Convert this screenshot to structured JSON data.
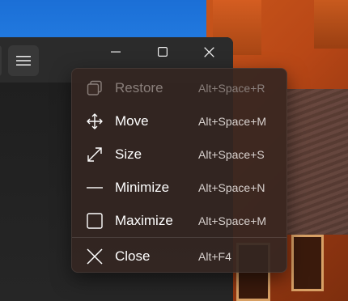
{
  "window": {
    "caption_buttons": {
      "minimize": "minimize-icon",
      "maximize": "maximize-icon",
      "close": "close-icon"
    },
    "hamburger": "hamburger-menu-icon"
  },
  "system_menu": {
    "items": [
      {
        "label": "Restore",
        "shortcut": "Alt+Space+R",
        "icon": "restore-icon",
        "enabled": false
      },
      {
        "label": "Move",
        "shortcut": "Alt+Space+M",
        "icon": "move-icon",
        "enabled": true
      },
      {
        "label": "Size",
        "shortcut": "Alt+Space+S",
        "icon": "size-icon",
        "enabled": true
      },
      {
        "label": "Minimize",
        "shortcut": "Alt+Space+N",
        "icon": "minimize-icon",
        "enabled": true
      },
      {
        "label": "Maximize",
        "shortcut": "Alt+Space+M",
        "icon": "maximize-icon",
        "enabled": true
      },
      {
        "label": "Close",
        "shortcut": "Alt+F4",
        "icon": "close-icon",
        "enabled": true
      }
    ]
  },
  "colors": {
    "menu_background": "#34261f",
    "window_background": "#202020",
    "titlebar": "#2b2b2b",
    "disabled_text": "#8a7f7b"
  }
}
